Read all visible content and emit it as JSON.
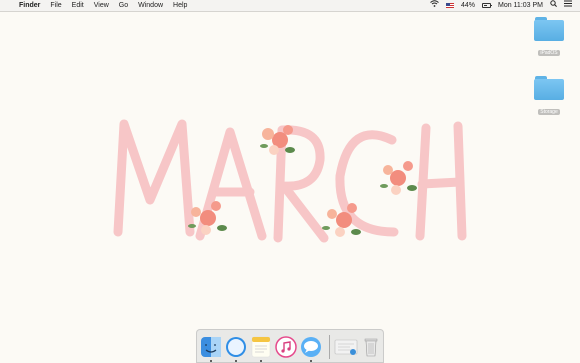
{
  "menubar": {
    "apple": "",
    "app_name": "Finder",
    "menus": [
      "File",
      "Edit",
      "View",
      "Go",
      "Window",
      "Help"
    ],
    "battery_percent": "44%",
    "clock": "Mon 11:03 PM"
  },
  "desktop": {
    "wallpaper_text": "MARCH",
    "folders": [
      {
        "label": "iPadOS"
      },
      {
        "label": "Storage"
      }
    ]
  },
  "dock": {
    "apps": [
      "Finder",
      "Safari",
      "Notes",
      "iTunes",
      "Messages",
      "Preview",
      "Trash"
    ],
    "running": [
      "Finder",
      "Safari",
      "Notes",
      "Messages"
    ]
  },
  "colors": {
    "letters": "#f7c6c7",
    "flowers": "#f28d7e",
    "folder": "#6ab9ea"
  }
}
